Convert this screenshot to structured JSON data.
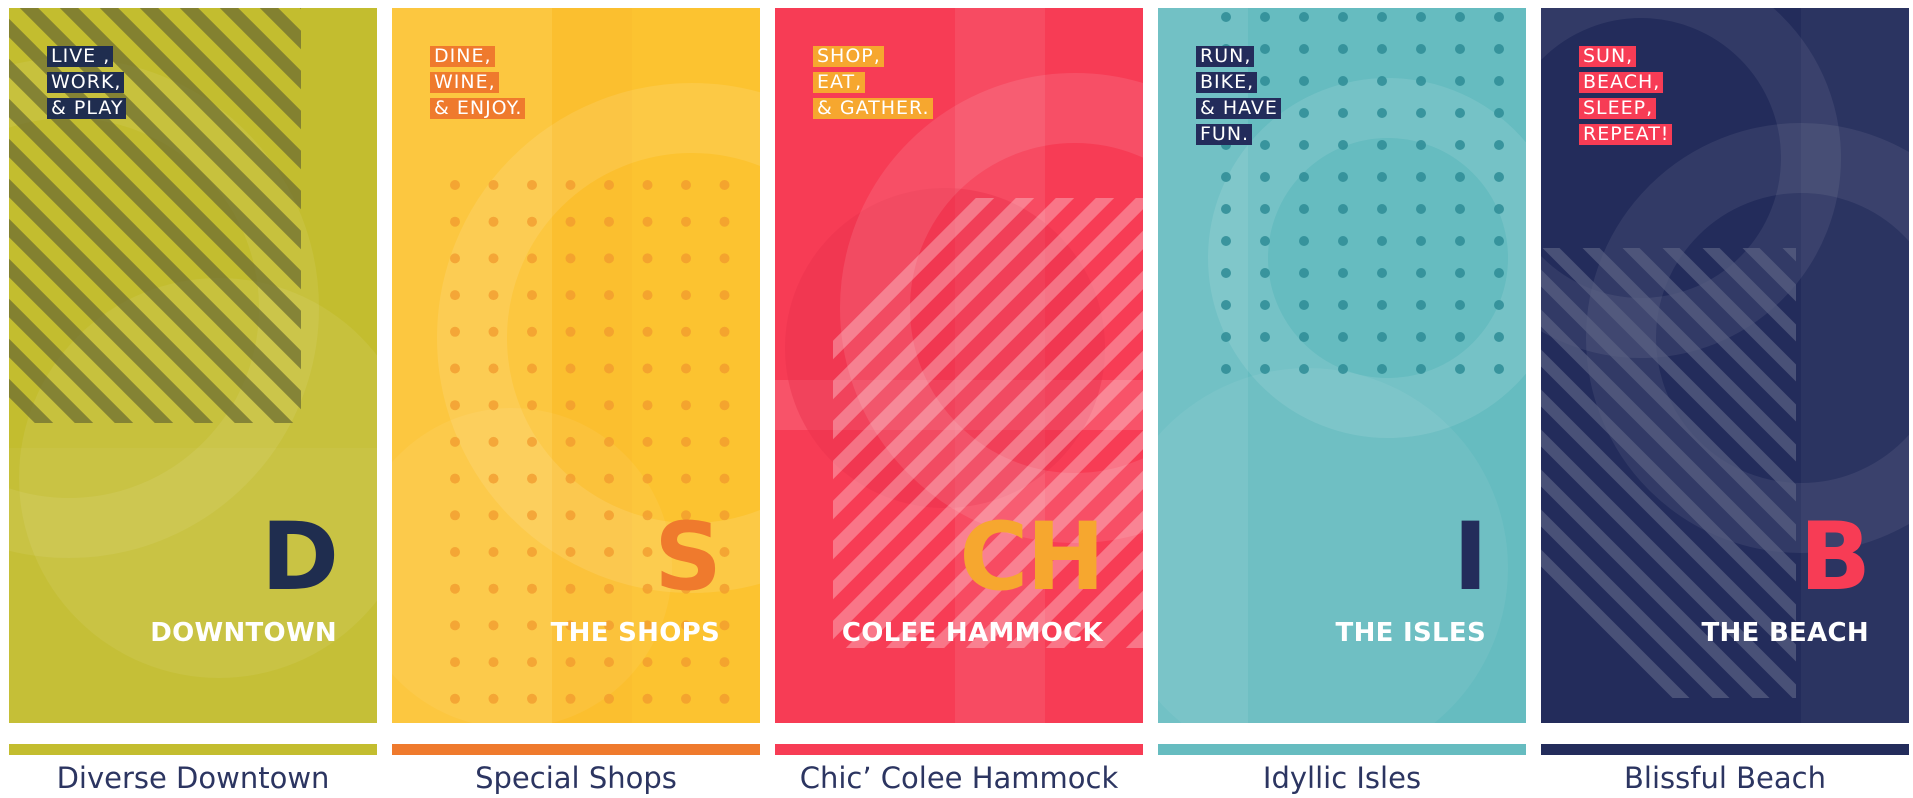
{
  "panels": [
    {
      "tags": [
        "LIVE ,",
        "WORK,",
        "& PLAY"
      ],
      "letter": "D",
      "name": "DOWNTOWN",
      "caption": "Diverse Downtown",
      "colors": {
        "bg": "#c3bd2f",
        "accent": "#1f2d4f",
        "tag_bg": "#1f2d4f",
        "tag_text": "#ffffff",
        "bar": "#c3bd2f"
      }
    },
    {
      "tags": [
        "DINE,",
        "WINE,",
        "& ENJOY."
      ],
      "letter": "S",
      "name": "THE SHOPS",
      "caption": "Special Shops",
      "colors": {
        "bg": "#fcc330",
        "accent": "#ef7a2d",
        "tag_bg": "#ef7a2d",
        "tag_text": "#ffffff",
        "bar": "#ef7a2d"
      }
    },
    {
      "tags": [
        "SHOP,",
        "EAT,",
        "& GATHER."
      ],
      "letter": "CH",
      "name": "COLEE HAMMOCK",
      "caption": "Chic’ Colee Hammock",
      "colors": {
        "bg": "#f73c55",
        "accent": "#f6a72f",
        "tag_bg": "#f6a72f",
        "tag_text": "#ffffff",
        "bar": "#f73c55"
      }
    },
    {
      "tags": [
        "RUN,",
        "BIKE,",
        "& HAVE",
        "FUN."
      ],
      "letter": "I",
      "name": "THE ISLES",
      "caption": "Idyllic Isles",
      "colors": {
        "bg": "#66bcc0",
        "accent": "#232c5b",
        "tag_bg": "#232c5b",
        "tag_text": "#ffffff",
        "bar": "#66bcc0"
      }
    },
    {
      "tags": [
        "SUN,",
        "BEACH,",
        "SLEEP,",
        "REPEAT!"
      ],
      "letter": "B",
      "name": "THE BEACH",
      "caption": "Blissful Beach",
      "colors": {
        "bg": "#232c5b",
        "accent": "#f73c55",
        "tag_bg": "#f73c55",
        "tag_text": "#ffffff",
        "bar": "#232c5b"
      }
    }
  ]
}
